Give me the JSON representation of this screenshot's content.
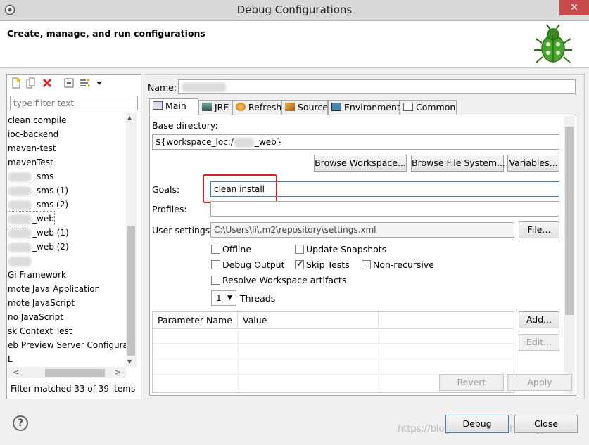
{
  "window": {
    "title": "Debug Configurations",
    "close_glyph": "✕"
  },
  "banner": {
    "heading": "Create, manage, and run configurations"
  },
  "toolbar": {
    "icons": [
      "new-config-icon",
      "duplicate-icon",
      "delete-icon",
      "collapse-all-icon",
      "filter-icon",
      "dropdown-arrow-icon"
    ]
  },
  "filter": {
    "placeholder": "type filter text",
    "status": "Filter matched 33 of 39 items"
  },
  "config_list": {
    "items": [
      {
        "text": "clean compile",
        "blur": false
      },
      {
        "text": "ioc-backend",
        "blur": false
      },
      {
        "text": "maven-test",
        "blur": false
      },
      {
        "text": "mavenTest",
        "blur": false
      },
      {
        "text": "_sms",
        "blur": true
      },
      {
        "text": "_sms (1)",
        "blur": true
      },
      {
        "text": "_sms (2)",
        "blur": true
      },
      {
        "text": "_web",
        "blur": true
      },
      {
        "text": "_web (1)",
        "blur": true
      },
      {
        "text": "_web (2)",
        "blur": true
      },
      {
        "text": "",
        "blur": true
      },
      {
        "text": "Gi Framework",
        "blur": false
      },
      {
        "text": "mote Java Application",
        "blur": false
      },
      {
        "text": "mote JavaScript",
        "blur": false
      },
      {
        "text": "no JavaScript",
        "blur": false
      },
      {
        "text": "sk Context Test",
        "blur": false
      },
      {
        "text": "eb Preview Server Configurat",
        "blur": false
      },
      {
        "text": "L",
        "blur": false
      }
    ],
    "scroll_up": "▲",
    "scroll_down": "▼",
    "scroll_left": "<",
    "scroll_right": ">"
  },
  "main": {
    "name_label": "Name:",
    "name_value": "",
    "tabs": [
      {
        "label": "Main",
        "icon": "main-tab-icon",
        "active": true
      },
      {
        "label": "JRE",
        "icon": "jre-icon",
        "active": false
      },
      {
        "label": "Refresh",
        "icon": "refresh-icon",
        "active": false
      },
      {
        "label": "Source",
        "icon": "source-icon",
        "active": false
      },
      {
        "label": "Environment",
        "icon": "environment-icon",
        "active": false
      },
      {
        "label": "Common",
        "icon": "common-icon",
        "active": false
      }
    ],
    "base_dir_label": "Base directory:",
    "base_dir_prefix": "${workspace_loc:/",
    "base_dir_suffix": "_web}",
    "browse_workspace": "Browse Workspace...",
    "browse_fs": "Browse File System...",
    "variables": "Variables...",
    "goals_label": "Goals:",
    "goals_value": "clean install",
    "profiles_label": "Profiles:",
    "profiles_value": "",
    "user_settings_label": "User settings:",
    "user_settings_value": "C:\\Users\\li\\.m2\\repository\\settings.xml",
    "file_button": "File...",
    "checkboxes": {
      "offline": {
        "label": "Offline",
        "checked": false
      },
      "update_snapshots": {
        "label": "Update Snapshots",
        "checked": false
      },
      "debug_output": {
        "label": "Debug Output",
        "checked": false
      },
      "skip_tests": {
        "label": "Skip Tests",
        "checked": true
      },
      "non_recursive": {
        "label": "Non-recursive",
        "checked": false
      },
      "resolve_workspace": {
        "label": "Resolve Workspace artifacts",
        "checked": false
      }
    },
    "threads_value": "1",
    "threads_label": "Threads",
    "param_table": {
      "columns": [
        "Parameter Name",
        "Value"
      ]
    },
    "add_button": "Add...",
    "edit_button": "Edit...",
    "revert_button": "Revert",
    "apply_button": "Apply"
  },
  "footer": {
    "help_glyph": "?",
    "debug_button": "Debug",
    "close_button": "Close",
    "watermark": "https://blog.csdn.net/technologyleader"
  }
}
